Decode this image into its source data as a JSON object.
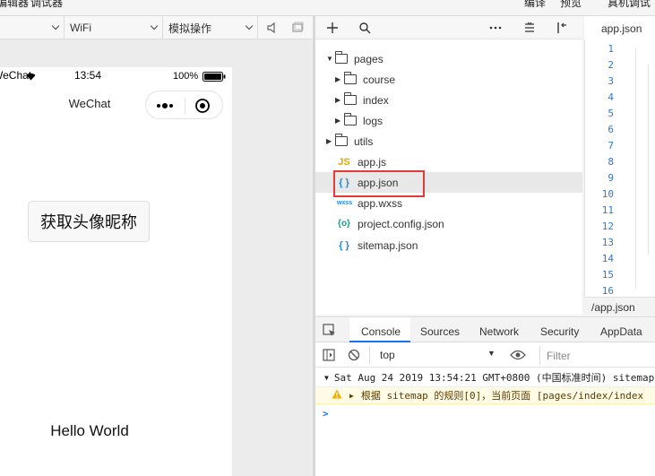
{
  "top_menu": [
    "编辑器",
    "调试器",
    "编译",
    "预览",
    "真机调试"
  ],
  "sim_toolbar": {
    "network": "WiFi",
    "operation": "模拟操作"
  },
  "status_bar": {
    "carrier": "WeChat",
    "time": "13:54",
    "battery": "100%"
  },
  "nav": {
    "title": "WeChat"
  },
  "page": {
    "button_label": "获取头像昵称",
    "hello": "Hello World"
  },
  "tree": {
    "items": [
      {
        "label": "pages",
        "type": "folder",
        "depth": 0,
        "expanded": true
      },
      {
        "label": "course",
        "type": "folder",
        "depth": 1
      },
      {
        "label": "index",
        "type": "folder",
        "depth": 1
      },
      {
        "label": "logs",
        "type": "folder",
        "depth": 1
      },
      {
        "label": "utils",
        "type": "folder",
        "depth": 0
      },
      {
        "label": "app.js",
        "type": "js",
        "icon": "JS"
      },
      {
        "label": "app.json",
        "type": "json",
        "icon": "{ }",
        "selected": true
      },
      {
        "label": "app.wxss",
        "type": "wxss",
        "icon": "wxss"
      },
      {
        "label": "project.config.json",
        "type": "config",
        "icon": "{o}"
      },
      {
        "label": "sitemap.json",
        "type": "json",
        "icon": "{ }"
      }
    ]
  },
  "editor": {
    "tab": "app.json",
    "line_numbers": [
      "1",
      "2",
      "3",
      "4",
      "5",
      "6",
      "7",
      "8",
      "9",
      "10",
      "11",
      "12",
      "13",
      "14",
      "15",
      "16"
    ],
    "path": "/app.json"
  },
  "devtools": {
    "tabs": [
      "Console",
      "Sources",
      "Network",
      "Security",
      "AppData"
    ],
    "active_tab": "Console",
    "context": "top",
    "filter_placeholder": "Filter",
    "log_line": "Sat Aug 24 2019 13:54:21 GMT+0800 (中国标准时间) sitemap",
    "warn_line": "根据 sitemap 的规则[0]，当前页面 [pages/index/index",
    "prompt": ">"
  },
  "colors": {
    "highlight_box": "#e53935",
    "selected_row": "#e8e8e8",
    "active_tab_underline": "#1a73e8",
    "js_icon": "#e6a700",
    "json_icon": "#1e88e5",
    "config_icon": "#14a085"
  }
}
